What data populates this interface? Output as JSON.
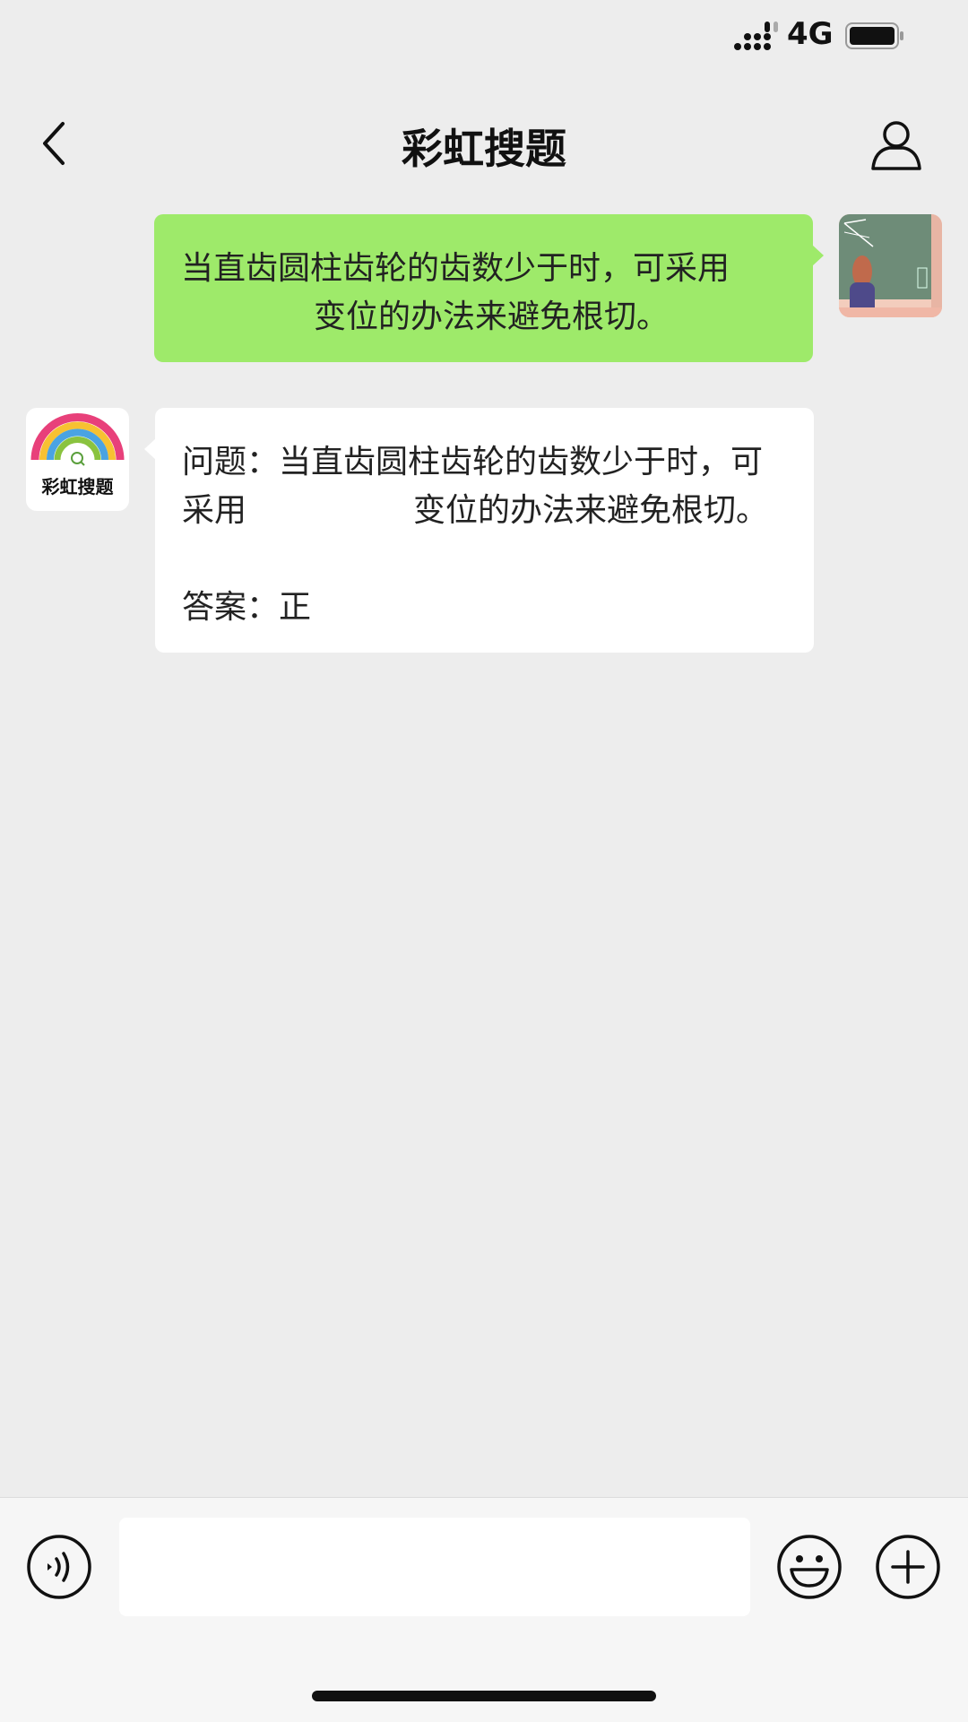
{
  "status_bar": {
    "network": "4G"
  },
  "nav": {
    "title": "彩虹搜题"
  },
  "messages": {
    "sent": {
      "line1": "当直齿圆柱齿轮的齿数少于时，可采用",
      "line2": "变位的办法来避免根切。"
    },
    "received": {
      "bot_name": "彩虹搜题",
      "question_line1": "问题：当直齿圆柱齿轮的齿数少于时，可",
      "question_line2a": "采用",
      "question_line2b": "变位的办法来避免根切。",
      "answer": "答案：正"
    }
  },
  "input": {
    "value": "",
    "placeholder": ""
  },
  "icons": {
    "back": "chevron-left-icon",
    "profile": "person-icon",
    "voice": "voice-icon",
    "emoji": "emoji-icon",
    "plus": "plus-icon"
  },
  "colors": {
    "background": "#ededed",
    "sent_bubble": "#9eea6a",
    "received_bubble": "#ffffff",
    "input_bar": "#f6f6f6"
  }
}
